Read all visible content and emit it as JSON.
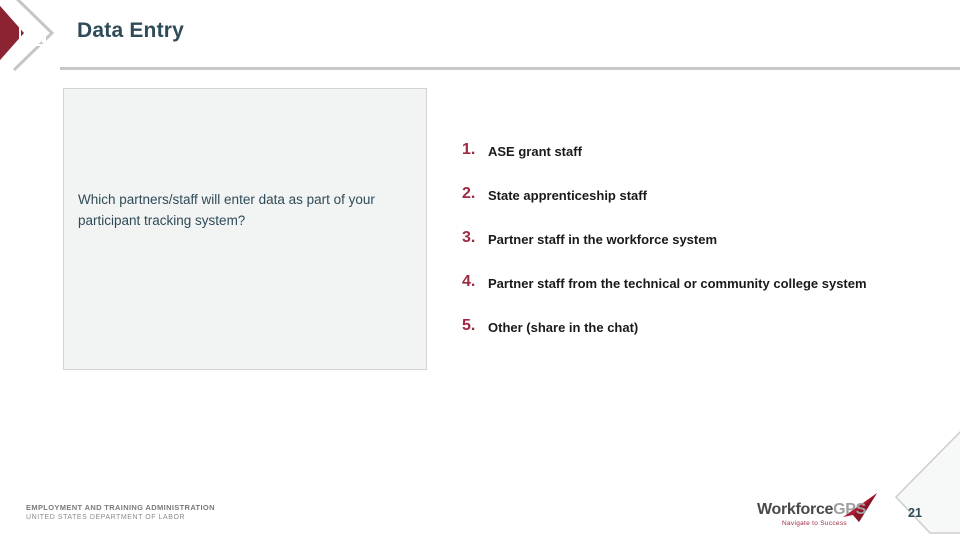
{
  "header": {
    "title": "Data Entry",
    "icon": "bar-chart-icon",
    "accent_color": "#8c2332",
    "title_color": "#2e4b57",
    "rule_color": "#c8c8c8"
  },
  "question": {
    "text": "Which partners/staff will enter data as part of your participant tracking system?",
    "box_fill": "#f2f3f3",
    "box_border": "#d4d4d4"
  },
  "answers": {
    "number_color": "#9e2a42",
    "items": [
      {
        "number": "1.",
        "label": "ASE grant staff"
      },
      {
        "number": "2.",
        "label": "State apprenticeship staff"
      },
      {
        "number": "3.",
        "label": "Partner staff in the workforce system"
      },
      {
        "number": "4.",
        "label": "Partner staff from the technical or community college system"
      },
      {
        "number": "5.",
        "label": "Other (share in the chat)"
      }
    ]
  },
  "footer": {
    "agency_line1": "EMPLOYMENT AND TRAINING ADMINISTRATION",
    "agency_line2": "UNITED STATES DEPARTMENT OF LABOR",
    "brand_name_part1": "Workforce",
    "brand_name_part2": "GPS",
    "brand_tagline": "Navigate to Success",
    "brand_arrow_icon": "red-arrow-icon",
    "page_number": "21"
  }
}
